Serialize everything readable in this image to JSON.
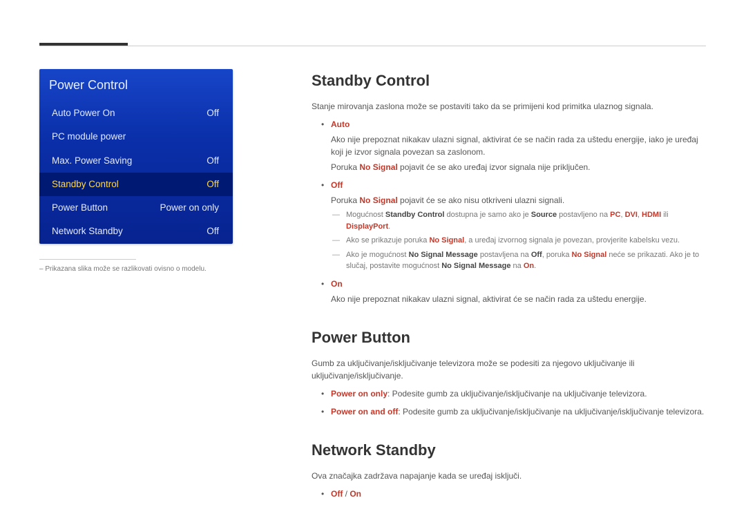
{
  "osd": {
    "title": "Power Control",
    "rows": [
      {
        "label": "Auto Power On",
        "value": "Off"
      },
      {
        "label": "PC module power",
        "value": ""
      },
      {
        "label": "Max. Power Saving",
        "value": "Off"
      },
      {
        "label": "Standby Control",
        "value": "Off",
        "highlighted": true
      },
      {
        "label": "Power Button",
        "value": "Power on only"
      },
      {
        "label": "Network Standby",
        "value": "Off"
      }
    ]
  },
  "footnote": "– Prikazana slika može se razlikovati ovisno o modelu.",
  "sections": {
    "standby": {
      "title": "Standby Control",
      "lead": "Stanje mirovanja zaslona može se postaviti tako da se primijeni kod primitka ulaznog signala.",
      "items": {
        "auto": {
          "name": "Auto",
          "body_line1": "Ako nije prepoznat nikakav ulazni signal, aktivirat će se način rada za uštedu energije, iako je uređaj koji je izvor signala povezan sa zaslonom.",
          "body_line2_pre": "Poruka ",
          "body_line2_red": "No Signal",
          "body_line2_post": " pojavit će se ako uređaj izvor signala nije priključen."
        },
        "off": {
          "name": "Off",
          "body_pre": "Poruka ",
          "body_red": "No Signal",
          "body_post": " pojavit će se ako nisu otkriveni ulazni signali.",
          "dashes": {
            "d1_a": "Mogućnost ",
            "d1_b": "Standby Control",
            "d1_c": " dostupna je samo ako je ",
            "d1_d": "Source",
            "d1_e": " postavljeno na ",
            "d1_f": "PC",
            "d1_g": ", ",
            "d1_h": "DVI",
            "d1_i": ", ",
            "d1_j": "HDMI",
            "d1_k": " ili ",
            "d1_l": "DisplayPort",
            "d1_m": ".",
            "d2_a": "Ako se prikazuje poruka ",
            "d2_b": "No Signal",
            "d2_c": ", a uređaj izvornog signala je povezan, provjerite kabelsku vezu.",
            "d3_a": "Ako je mogućnost ",
            "d3_b": "No Signal Message",
            "d3_c": " postavljena na ",
            "d3_d": "Off",
            "d3_e": ", poruka ",
            "d3_f": "No Signal",
            "d3_g": " neće se prikazati. Ako je to slučaj, postavite mogućnost ",
            "d3_h": "No Signal Message",
            "d3_i": " na ",
            "d3_j": "On",
            "d3_k": "."
          }
        },
        "on": {
          "name": "On",
          "body": "Ako nije prepoznat nikakav ulazni signal, aktivirat će se način rada za uštedu energije."
        }
      }
    },
    "power_button": {
      "title": "Power Button",
      "lead": "Gumb za uključivanje/isključivanje televizora može se podesiti za njegovo uključivanje ili uključivanje/isključivanje.",
      "opt1_name": "Power on only",
      "opt1_body": ": Podesite gumb za uključivanje/isključivanje na uključivanje televizora.",
      "opt2_name": "Power on and off",
      "opt2_body": ": Podesite gumb za uključivanje/isključivanje na uključivanje/isključivanje televizora."
    },
    "network_standby": {
      "title": "Network Standby",
      "lead": "Ova značajka zadržava napajanje kada se uređaj isključi.",
      "opt_off": "Off",
      "opt_sep": " / ",
      "opt_on": "On"
    }
  }
}
